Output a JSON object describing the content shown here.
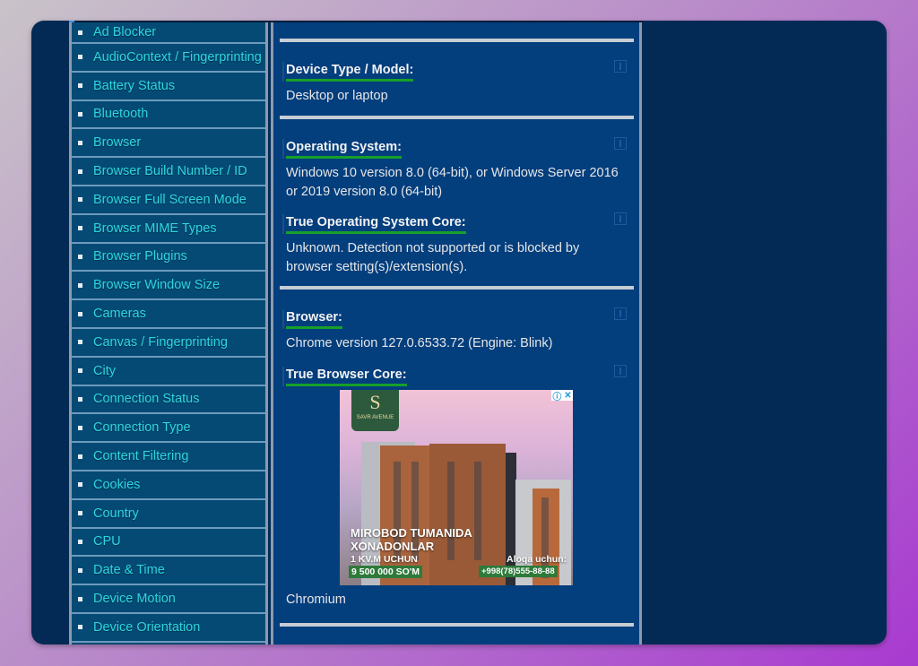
{
  "sidebar": {
    "items": [
      {
        "label": "Ad Blocker"
      },
      {
        "label": "AudioContext / Fingerprinting"
      },
      {
        "label": "Battery Status"
      },
      {
        "label": "Bluetooth"
      },
      {
        "label": "Browser"
      },
      {
        "label": "Browser Build Number / ID"
      },
      {
        "label": "Browser Full Screen Mode"
      },
      {
        "label": "Browser MIME Types"
      },
      {
        "label": "Browser Plugins"
      },
      {
        "label": "Browser Window Size"
      },
      {
        "label": "Cameras"
      },
      {
        "label": "Canvas / Fingerprinting"
      },
      {
        "label": "City"
      },
      {
        "label": "Connection Status"
      },
      {
        "label": "Connection Type"
      },
      {
        "label": "Content Filtering"
      },
      {
        "label": "Cookies"
      },
      {
        "label": "Country"
      },
      {
        "label": "CPU"
      },
      {
        "label": "Date & Time"
      },
      {
        "label": "Device Motion"
      },
      {
        "label": "Device Orientation"
      }
    ]
  },
  "main": {
    "fields": [
      {
        "label": "Device Type / Model:",
        "value": "Desktop or laptop"
      },
      {
        "label": "Operating System:",
        "value": "Windows 10 version 8.0 (64-bit), or Windows Server 2016 or 2019 version 8.0 (64-bit)"
      },
      {
        "label": "True Operating System Core:",
        "value": "Unknown. Detection not supported or is blocked by browser setting(s)/extension(s)."
      },
      {
        "label": "Browser:",
        "value": "Chrome version 127.0.6533.72 (Engine: Blink)"
      },
      {
        "label": "True Browser Core:",
        "value": "Chromium"
      }
    ],
    "info_icon": "info-icon"
  },
  "ad": {
    "brand": "SAVR AVENUE",
    "brand_mark": "S",
    "headline_1": "MIROBOD TUMANIDA",
    "headline_2": "XONADONLAR",
    "per_unit": "1 KV.M UCHUN",
    "price": "9 500 000 SO'M",
    "contact_label": "Aloqa uchun:",
    "phone": "+998(78)555-88-88",
    "info_glyph": "ⓘ",
    "close_glyph": "✕"
  },
  "colors": {
    "link": "#2fd6e0",
    "label_underline": "#17a02a",
    "panel_bg": "#033e7d",
    "sidebar_bg": "#044a74"
  }
}
